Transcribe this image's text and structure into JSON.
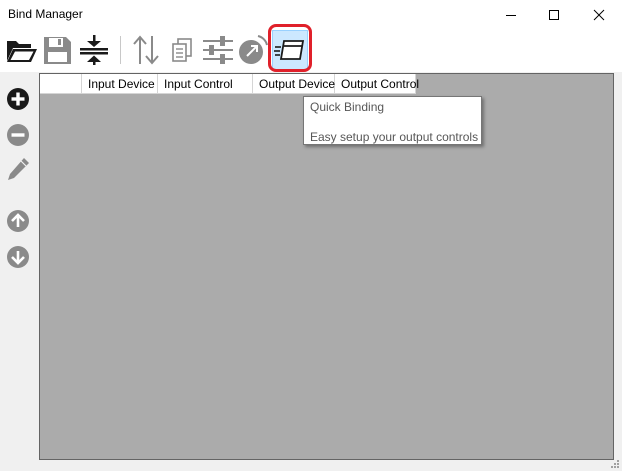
{
  "window": {
    "title": "Bind Manager",
    "controls": {
      "minimize": "minimize-icon",
      "maximize": "maximize-icon",
      "close": "close-icon"
    }
  },
  "toolbar": {
    "icons": [
      "folder-open-icon",
      "save-icon",
      "collapse-icon",
      "sort-icon",
      "copy-icon",
      "sliders-icon",
      "calibrate-icon",
      "quick-binding-icon"
    ],
    "active": "quick-binding-icon",
    "highlight_color": "#e0202a"
  },
  "sidebar": {
    "icons": [
      "add-icon",
      "remove-icon",
      "edit-icon",
      "move-up-icon",
      "move-down-icon"
    ]
  },
  "grid": {
    "columns": [
      "",
      "Input Device",
      "Input Control",
      "Output Device",
      "Output Control"
    ],
    "background": "#ababab"
  },
  "tooltip": {
    "title": "Quick Binding",
    "description": "Easy setup your output controls"
  }
}
